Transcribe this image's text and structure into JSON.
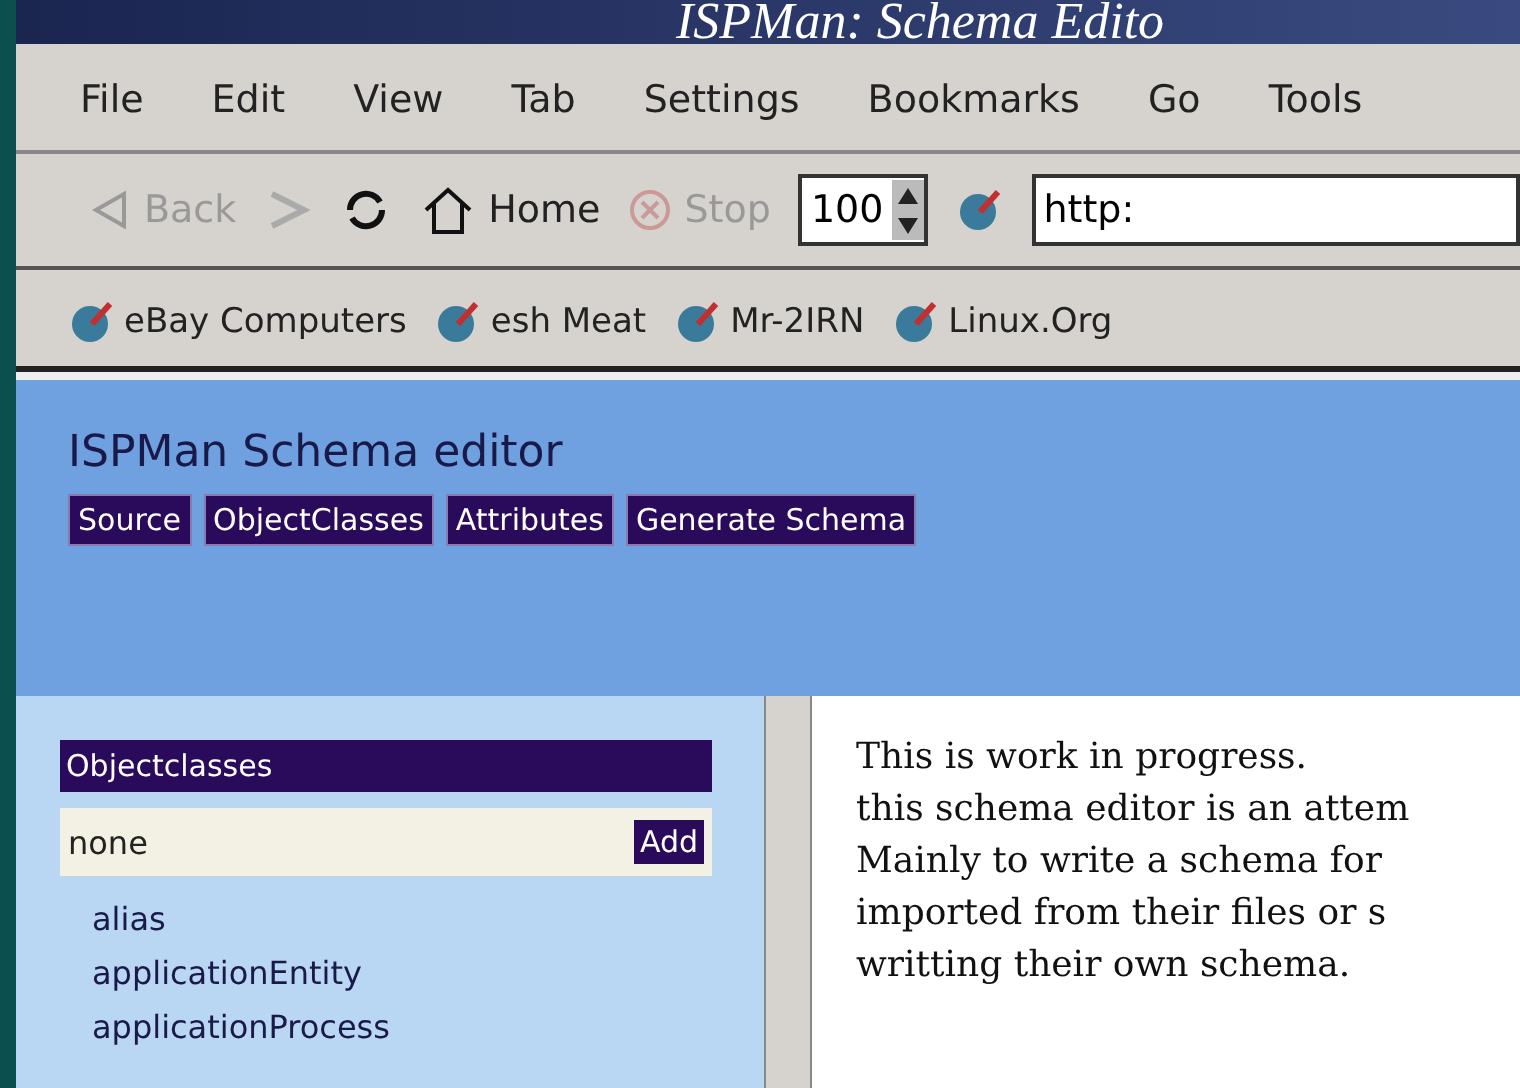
{
  "slide_title": "ISPMan: Schema Edito",
  "menu": [
    "File",
    "Edit",
    "View",
    "Tab",
    "Settings",
    "Bookmarks",
    "Go",
    "Tools"
  ],
  "toolbar": {
    "back": "Back",
    "home": "Home",
    "stop": "Stop",
    "zoom": "100",
    "url": "http:"
  },
  "bookmarks": [
    "eBay Computers",
    "esh Meat",
    "Mr-2IRN",
    "Linux.Org"
  ],
  "page": {
    "title": "ISPMan Schema editor",
    "nav": [
      "Source",
      "ObjectClasses",
      "Attributes",
      "Generate Schema"
    ],
    "panel": {
      "header": "Objectclasses",
      "field_value": "none",
      "add": "Add",
      "items": [
        "alias",
        "applicationEntity",
        "applicationProcess"
      ]
    },
    "text": [
      "This is work in progress.",
      "this schema editor is an attem",
      "Mainly to write a schema for",
      "imported from their files or s",
      "writting their own schema."
    ]
  }
}
